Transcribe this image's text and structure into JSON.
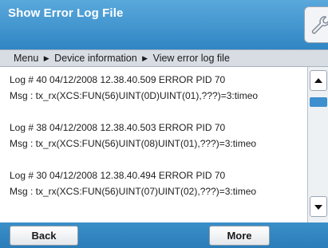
{
  "window": {
    "title": "Show Error Log File",
    "tool_icon": "wrench-icon"
  },
  "breadcrumb": {
    "items": [
      "Menu",
      "Device information",
      "View error log file"
    ],
    "separator": "▶"
  },
  "log_entries": [
    {
      "header": "Log # 40  04/12/2008  12.38.40.509  ERROR  PID  70",
      "message": "Msg : tx_rx(XCS:FUN(56)UINT(0D)UINT(01),???)=3:timeo"
    },
    {
      "header": "Log # 38  04/12/2008  12.38.40.503  ERROR  PID  70",
      "message": "Msg : tx_rx(XCS:FUN(56)UINT(08)UINT(01),???)=3:timeo"
    },
    {
      "header": "Log # 30  04/12/2008  12.38.40.494  ERROR  PID  70",
      "message": "Msg : tx_rx(XCS:FUN(56)UINT(07)UINT(02),???)=3:timeo"
    }
  ],
  "scroll": {
    "position": 0.05
  },
  "buttons": {
    "back": "Back",
    "more": "More"
  },
  "colors": {
    "accent": "#3a8fc8",
    "thumb": "#3e8fd0"
  }
}
